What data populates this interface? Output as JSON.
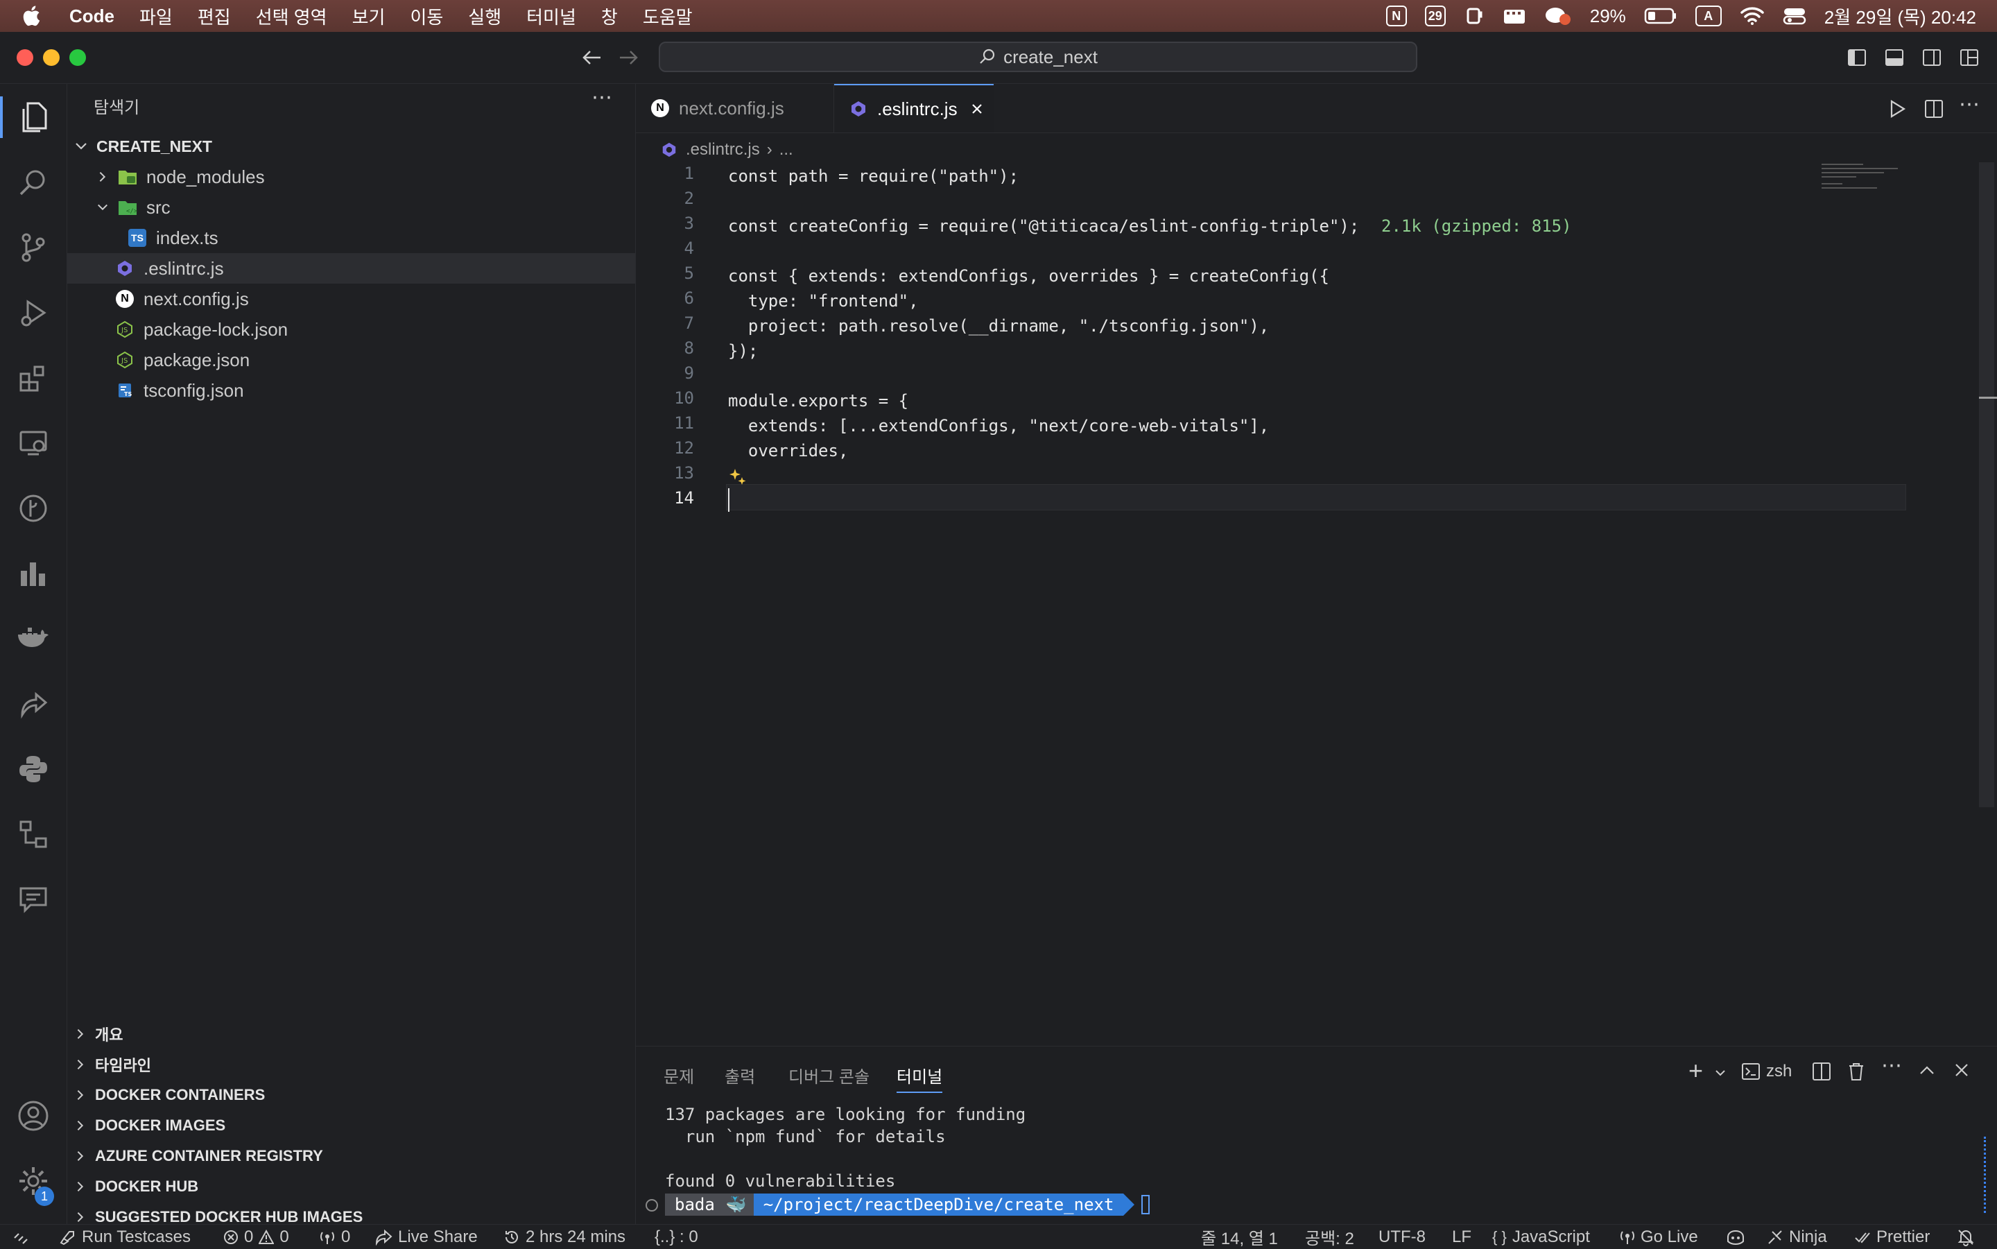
{
  "menubar": {
    "app": "Code",
    "items": [
      "파일",
      "편집",
      "선택 영역",
      "보기",
      "이동",
      "실행",
      "터미널",
      "창",
      "도움말"
    ],
    "calendar_day": "29",
    "battery": "29%",
    "input_method": "A",
    "datetime": "2월 29일 (목) 20:42"
  },
  "titlebar": {
    "search_text": "create_next"
  },
  "sidebar": {
    "title": "탐색기",
    "project": "CREATE_NEXT",
    "tree": [
      {
        "label": "node_modules",
        "icon": "folder-node-icon",
        "indent": 0,
        "chevron": "right"
      },
      {
        "label": "src",
        "icon": "folder-src-icon",
        "indent": 0,
        "chevron": "down"
      },
      {
        "label": "index.ts",
        "icon": "ts-file-icon",
        "indent": 1,
        "chevron": ""
      },
      {
        "label": ".eslintrc.js",
        "icon": "eslint-file-icon",
        "indent": 0,
        "chevron": "",
        "selected": true
      },
      {
        "label": "next.config.js",
        "icon": "next-file-icon",
        "indent": 0,
        "chevron": ""
      },
      {
        "label": "package-lock.json",
        "icon": "npm-file-icon",
        "indent": 0,
        "chevron": ""
      },
      {
        "label": "package.json",
        "icon": "npm-file-icon",
        "indent": 0,
        "chevron": ""
      },
      {
        "label": "tsconfig.json",
        "icon": "tsconfig-file-icon",
        "indent": 0,
        "chevron": ""
      }
    ],
    "sections": [
      "개요",
      "타임라인",
      "DOCKER CONTAINERS",
      "DOCKER IMAGES",
      "AZURE CONTAINER REGISTRY",
      "DOCKER HUB",
      "SUGGESTED DOCKER HUB IMAGES"
    ]
  },
  "tabs": [
    {
      "label": "next.config.js",
      "icon": "next-file-icon",
      "active": false
    },
    {
      "label": ".eslintrc.js",
      "icon": "eslint-file-icon",
      "active": true
    }
  ],
  "breadcrumb": {
    "file": ".eslintrc.js",
    "rest": "..."
  },
  "code_lines": [
    "1",
    "2",
    "3",
    "4",
    "5",
    "6",
    "7",
    "8",
    "9",
    "10",
    "11",
    "12",
    "13",
    "14"
  ],
  "code": {
    "l1": "const path = require(\"path\");",
    "l3": "const createConfig = require(\"@titicaca/eslint-config-triple\");",
    "l3_size": "2.1k (gzipped: 815)",
    "l5": "const { extends: extendConfigs, overrides } = createConfig({",
    "l6": "  type: \"frontend\",",
    "l7": "  project: path.resolve(__dirname, \"./tsconfig.json\"),",
    "l8": "});",
    "l10": "module.exports = {",
    "l11": "  extends: [...extendConfigs, \"next/core-web-vitals\"],",
    "l12": "  overrides,"
  },
  "panel": {
    "tabs": [
      "문제",
      "출력",
      "디버그 콘솔",
      "터미널"
    ],
    "shell": "zsh",
    "lines": [
      "137 packages are looking for funding",
      "  run `npm fund` for details",
      "",
      "found 0 vulnerabilities"
    ],
    "prompt_user": "bada",
    "prompt_path": "~/project/reactDeepDive/create_next"
  },
  "status": {
    "run_testcases": "Run Testcases",
    "errors": "0",
    "warnings": "0",
    "ports": "0",
    "live_share": "Live Share",
    "time": "2 hrs 24 mins",
    "json": "{..} : 0",
    "position": "줄 14, 열 1",
    "spaces": "공백: 2",
    "encoding": "UTF-8",
    "eol": "LF",
    "language": "JavaScript",
    "go_live": "Go Live",
    "ninja": "Ninja",
    "prettier": "Prettier",
    "notif_count": "1"
  }
}
